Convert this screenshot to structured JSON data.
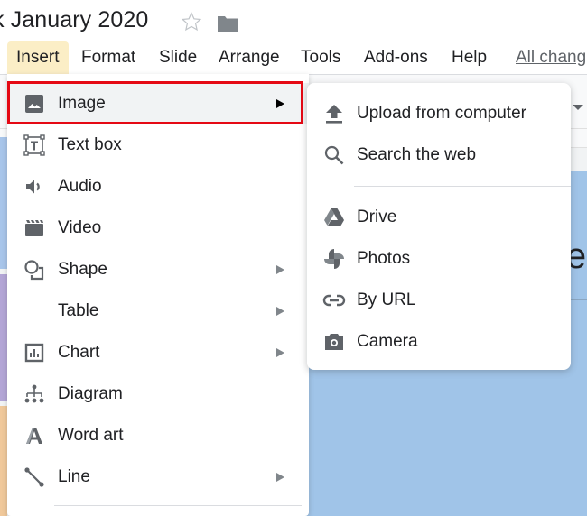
{
  "document": {
    "title": "k January 2020"
  },
  "menubar": {
    "items": [
      {
        "label": "Insert",
        "active": true
      },
      {
        "label": "Format"
      },
      {
        "label": "Slide"
      },
      {
        "label": "Arrange"
      },
      {
        "label": "Tools"
      },
      {
        "label": "Add-ons"
      },
      {
        "label": "Help"
      }
    ],
    "save_status": "All chang"
  },
  "insert_menu": {
    "items": [
      {
        "label": "Image",
        "icon": "image-icon",
        "has_submenu": true,
        "highlighted": true
      },
      {
        "label": "Text box",
        "icon": "text-box-icon",
        "has_submenu": false
      },
      {
        "label": "Audio",
        "icon": "audio-icon",
        "has_submenu": false
      },
      {
        "label": "Video",
        "icon": "video-icon",
        "has_submenu": false
      },
      {
        "label": "Shape",
        "icon": "shape-icon",
        "has_submenu": true
      },
      {
        "label": "Table",
        "icon": "",
        "has_submenu": true
      },
      {
        "label": "Chart",
        "icon": "chart-icon",
        "has_submenu": true
      },
      {
        "label": "Diagram",
        "icon": "diagram-icon",
        "has_submenu": false
      },
      {
        "label": "Word art",
        "icon": "word-art-icon",
        "has_submenu": false
      },
      {
        "label": "Line",
        "icon": "line-icon",
        "has_submenu": true
      }
    ]
  },
  "image_submenu": {
    "items": [
      {
        "label": "Upload from computer",
        "icon": "upload-icon"
      },
      {
        "label": "Search the web",
        "icon": "search-icon"
      },
      {
        "label": "Drive",
        "icon": "drive-icon"
      },
      {
        "label": "Photos",
        "icon": "photos-icon"
      },
      {
        "label": "By URL",
        "icon": "link-icon"
      },
      {
        "label": "Camera",
        "icon": "camera-icon"
      }
    ]
  },
  "slide": {
    "partial_title": "le",
    "background_color": "#a0c4e8"
  },
  "colors": {
    "highlight_border": "#e50914",
    "active_menu_bg": "#fbeec6",
    "icon_gray": "#5f6368",
    "thumbnail_colors": [
      "#a8c5ea",
      "#b3a5d6",
      "#f0c89a"
    ]
  }
}
